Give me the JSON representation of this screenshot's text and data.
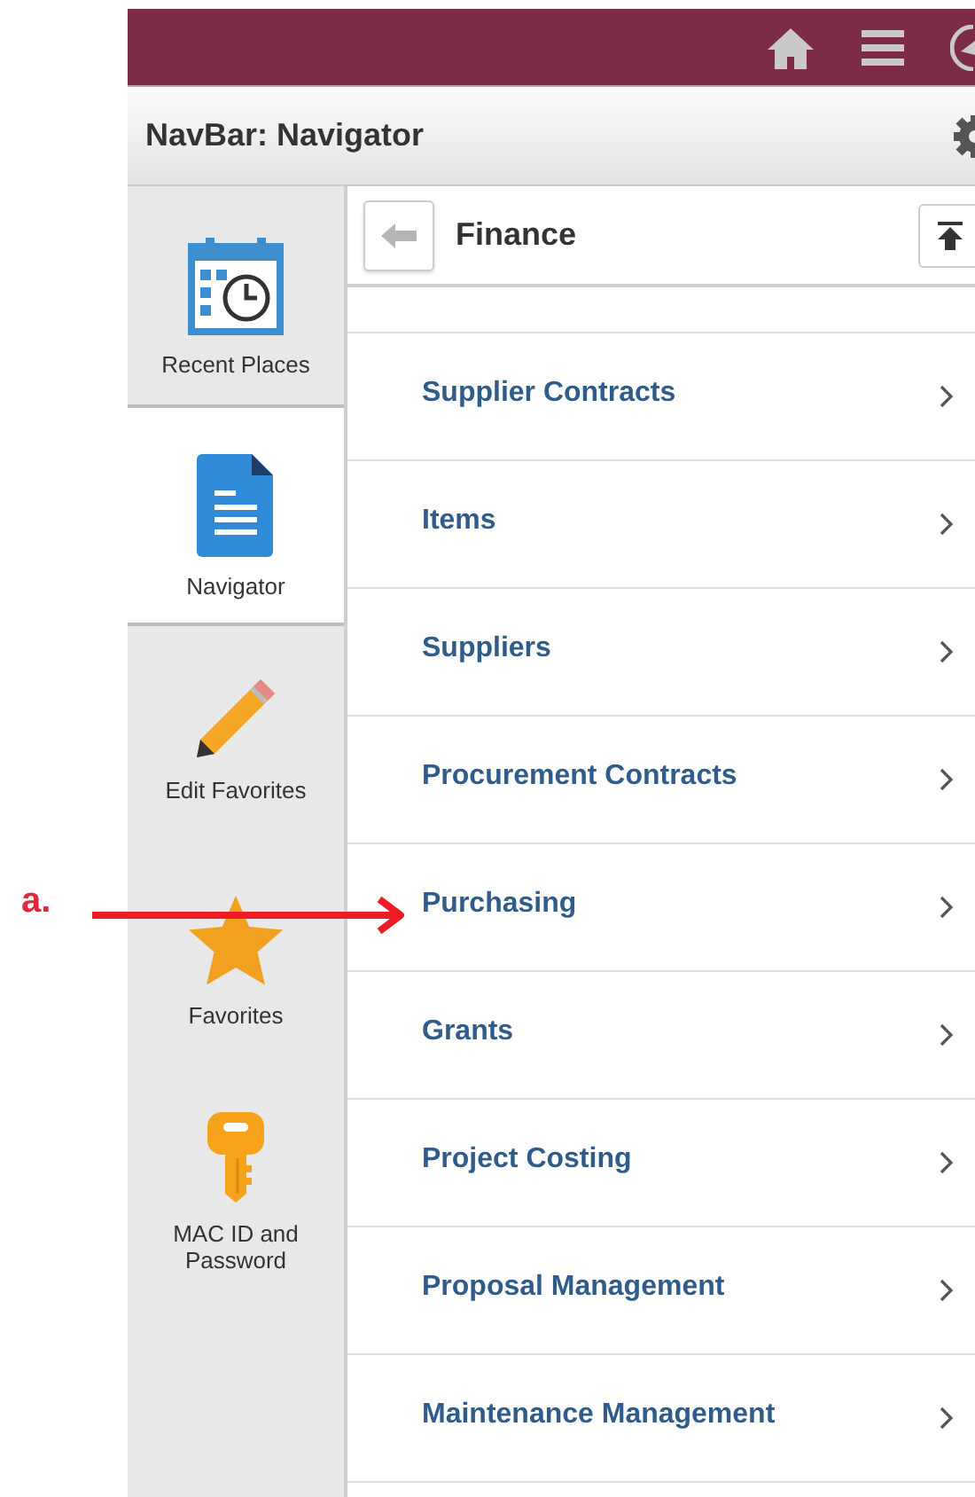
{
  "header": {
    "title": "NavBar: Navigator"
  },
  "sidebar": {
    "items": [
      {
        "label": "Recent Places",
        "kind": "calendar",
        "selected": false
      },
      {
        "label": "Navigator",
        "kind": "document",
        "selected": true
      },
      {
        "label": "Edit Favorites",
        "kind": "pencil",
        "selected": false
      },
      {
        "label": "Favorites",
        "kind": "star",
        "selected": false
      },
      {
        "label": "MAC ID and Password",
        "kind": "key",
        "selected": false
      }
    ]
  },
  "panel": {
    "title": "Finance",
    "items": [
      {
        "label": "Supplier Contracts"
      },
      {
        "label": "Items"
      },
      {
        "label": "Suppliers"
      },
      {
        "label": "Procurement Contracts"
      },
      {
        "label": "Purchasing"
      },
      {
        "label": "Grants"
      },
      {
        "label": "Project Costing"
      },
      {
        "label": "Proposal Management"
      },
      {
        "label": "Maintenance Management"
      }
    ]
  },
  "annotation": {
    "label": "a."
  }
}
